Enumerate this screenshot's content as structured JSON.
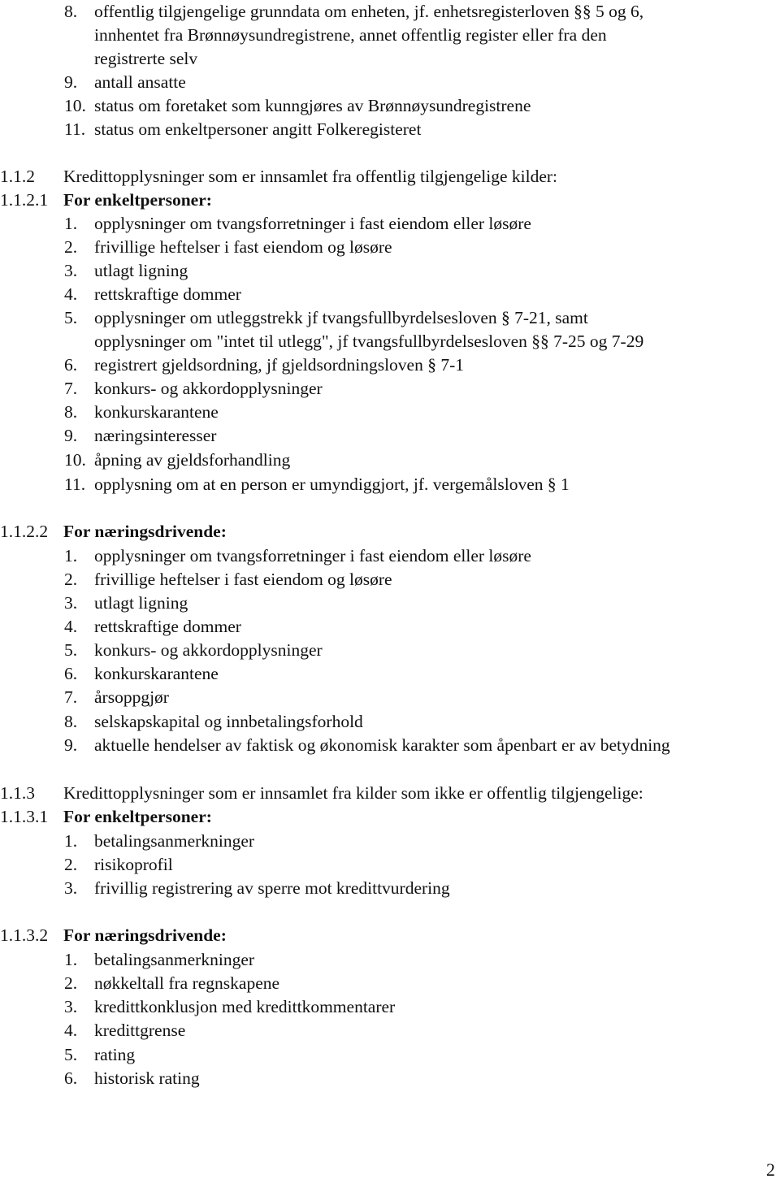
{
  "document": {
    "top_list": {
      "items": [
        {
          "num": "8.",
          "lines": [
            "offentlig tilgjengelige grunndata om enheten, jf. enhetsregisterloven §§ 5 og 6,",
            "innhentet fra Brønnøysundregistrene, annet offentlig register eller fra den",
            "registrerte selv"
          ]
        },
        {
          "num": "9.",
          "lines": [
            "antall ansatte"
          ]
        },
        {
          "num": "10.",
          "lines": [
            "status om foretaket som kunngjøres av Brønnøysundregistrene"
          ]
        },
        {
          "num": "11.",
          "lines": [
            "status om enkeltpersoner angitt Folkeregisteret"
          ]
        }
      ]
    },
    "section_1_1_2": {
      "number": "1.1.2",
      "title": "Kredittopplysninger som er innsamlet fra offentlig tilgjengelige kilder:",
      "sub1": {
        "number": "1.1.2.1",
        "title": "For enkeltpersoner:",
        "items": [
          {
            "num": "1.",
            "lines": [
              "opplysninger om tvangsforretninger i fast eiendom eller løsøre"
            ]
          },
          {
            "num": "2.",
            "lines": [
              "frivillige heftelser i fast eiendom og løsøre"
            ]
          },
          {
            "num": "3.",
            "lines": [
              "utlagt ligning"
            ]
          },
          {
            "num": "4.",
            "lines": [
              "rettskraftige dommer"
            ]
          },
          {
            "num": "5.",
            "lines": [
              "opplysninger om utleggstrekk jf tvangsfullbyrdelsesloven § 7-21, samt",
              "opplysninger om \"intet til utlegg\", jf tvangsfullbyrdelsesloven §§ 7-25 og 7-29"
            ]
          },
          {
            "num": "6.",
            "lines": [
              "registrert gjeldsordning, jf gjeldsordningsloven § 7-1"
            ]
          },
          {
            "num": "7.",
            "lines": [
              "konkurs- og akkordopplysninger"
            ]
          },
          {
            "num": "8.",
            "lines": [
              "konkurskarantene"
            ]
          },
          {
            "num": "9.",
            "lines": [
              "næringsinteresser"
            ]
          },
          {
            "num": "10.",
            "lines": [
              "åpning av gjeldsforhandling"
            ]
          },
          {
            "num": "11.",
            "lines": [
              "opplysning om at en person er umyndiggjort, jf. vergemålsloven § 1"
            ]
          }
        ]
      },
      "sub2": {
        "number": "1.1.2.2",
        "title": "For næringsdrivende:",
        "items": [
          {
            "num": "1.",
            "lines": [
              "opplysninger om tvangsforretninger i fast eiendom eller løsøre"
            ]
          },
          {
            "num": "2.",
            "lines": [
              "frivillige heftelser i fast eiendom og løsøre"
            ]
          },
          {
            "num": "3.",
            "lines": [
              "utlagt ligning"
            ]
          },
          {
            "num": "4.",
            "lines": [
              "rettskraftige dommer"
            ]
          },
          {
            "num": "5.",
            "lines": [
              "konkurs- og akkordopplysninger"
            ]
          },
          {
            "num": "6.",
            "lines": [
              "konkurskarantene"
            ]
          },
          {
            "num": "7.",
            "lines": [
              "årsoppgjør"
            ]
          },
          {
            "num": "8.",
            "lines": [
              "selskapskapital og innbetalingsforhold"
            ]
          },
          {
            "num": "9.",
            "lines": [
              "aktuelle hendelser av faktisk og økonomisk karakter som åpenbart er av betydning"
            ]
          }
        ]
      }
    },
    "section_1_1_3": {
      "number": "1.1.3",
      "title": "Kredittopplysninger som er innsamlet fra kilder som ikke er offentlig tilgjengelige:",
      "sub1": {
        "number": "1.1.3.1",
        "title": "For enkeltpersoner:",
        "items": [
          {
            "num": "1.",
            "lines": [
              "betalingsanmerkninger"
            ]
          },
          {
            "num": "2.",
            "lines": [
              "risikoprofil"
            ]
          },
          {
            "num": "3.",
            "lines": [
              "frivillig registrering av sperre mot kredittvurdering"
            ]
          }
        ]
      },
      "sub2": {
        "number": "1.1.3.2",
        "title": "For næringsdrivende:",
        "items": [
          {
            "num": "1.",
            "lines": [
              "betalingsanmerkninger"
            ]
          },
          {
            "num": "2.",
            "lines": [
              "nøkkeltall fra regnskapene"
            ]
          },
          {
            "num": "3.",
            "lines": [
              "kredittkonklusjon med kredittkommentarer"
            ]
          },
          {
            "num": "4.",
            "lines": [
              "kredittgrense"
            ]
          },
          {
            "num": "5.",
            "lines": [
              "rating"
            ]
          },
          {
            "num": "6.",
            "lines": [
              "historisk rating"
            ]
          }
        ]
      }
    },
    "page_number": "2"
  }
}
